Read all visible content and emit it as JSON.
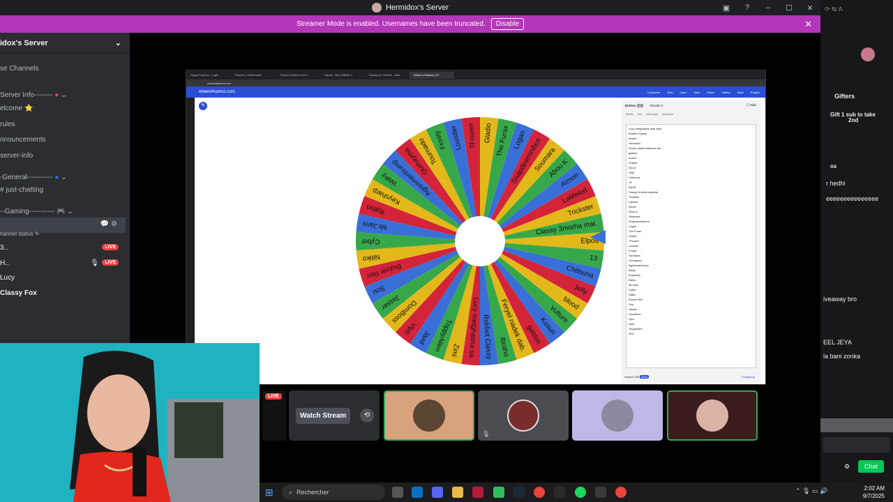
{
  "titlebar": {
    "title": "Hermidox's Server"
  },
  "banner": {
    "text": "Streamer Mode is enabled. Usernames have been truncated.",
    "disable_label": "Disable"
  },
  "sidebar": {
    "server_name": "idox's Server",
    "items": [
      {
        "label": "se Channels"
      },
      {
        "label": "Server Info--------"
      },
      {
        "label": "elcome ⭐"
      },
      {
        "label": "rules"
      },
      {
        "label": "nnouncements"
      },
      {
        "label": "server-info"
      },
      {
        "label": "-General-----------"
      },
      {
        "label": "just-chatting"
      },
      {
        "label": "--Gaming----------- 🎮"
      }
    ],
    "channel_status": "hannel status",
    "members": [
      {
        "name": "3..",
        "live": "LIVE"
      },
      {
        "name": "H..",
        "live": "LIVE"
      },
      {
        "name": "Lucy"
      },
      {
        "name": "Classy Fox"
      }
    ]
  },
  "browser": {
    "tabs": [
      "Skype Express - Login",
      "Reactor | Maréchales",
      "Themed Drafted and V",
      "Naruto - Bon Difficile V",
      "Racing Dx Stricker - Wiki",
      "Wheel of Names | Fr"
    ],
    "url": "wheelofnames.com",
    "site": "wheelofnames.com",
    "menu": [
      "Customize",
      "New",
      "Open",
      "Save",
      "Share",
      "Gallery",
      "More",
      "English"
    ],
    "entries_tab": "Entries",
    "entries_count": "49",
    "results_tab": "Results",
    "results_count": "0",
    "hide_label": "Hide",
    "tools": [
      "Shuffle",
      "Sort",
      "Add image",
      "Advanced"
    ],
    "entries": [
      "Lucy metghasha sala Jelly",
      "Rokbet Classy",
      "Ibraho",
      "Hermidox",
      "Feryel nadek dabouza mé",
      "gaston",
      "Kosuri",
      "Vulture",
      "blood",
      "Jelly",
      "Chifouna",
      "13",
      "Elpo9",
      "Classy 3morha mats3ar",
      "Trickster",
      "Lalelod",
      "Aimon",
      "Abou K",
      "Soumara",
      "Snapdesminibus",
      "Logan",
      "The Furax",
      "Gladio",
      "TFrozen",
      "Loustler",
      "Frosty",
      "Tournado",
      "Oumayma",
      "Agreementrump",
      "Waky",
      "Keysharp",
      "Rafoo",
      "Mr.Jans",
      "Cyber",
      "Nitiko",
      "Buzzer Rec",
      "Sou",
      "Jasser",
      "DomBoss",
      "Vipo",
      "Jaxd",
      "TrippyAlien",
      "Zimi"
    ],
    "version": "Version 378",
    "version_badge": "New!",
    "changelog": "Changelog"
  },
  "wheel": {
    "colors": [
      "#e3b81a",
      "#37a84a",
      "#3a6fd8",
      "#d4243a"
    ],
    "labels": [
      "Elpo9",
      "13",
      "Chifouna",
      "Jelly",
      "blood",
      "Vulture",
      "Kosuri",
      "gaston",
      "Feryel nadek dab.",
      "Ibraho",
      "Rokbet Classy",
      "Lucy metghasha sa.",
      "Zimi",
      "TrippyAlien",
      "Jaxd",
      "Vipo",
      "DomBoss",
      "Jasser",
      "Sou",
      "Buzzer Rec",
      "Nitiko",
      "Cyber",
      "Mr.Jans",
      "Rafoo",
      "Keysharp",
      "Waky",
      "Agreementrump",
      "Oumayma",
      "Tournado",
      "Frosty",
      "Loustler",
      "TFrozen",
      "Gladio",
      "The Furax",
      "Logan",
      "Snapdesminibus",
      "Soumara",
      "Abou K",
      "Aimon",
      "LaMelod",
      "Trickster",
      "Classy 3morha mat."
    ]
  },
  "tiles": {
    "live_badge": "LIVE",
    "watch_label": "Watch Stream"
  },
  "rightpanel": {
    "gifters": "Gifters",
    "gift_line1": "Gift 1 sub to take",
    "gift_line2": "2nd",
    "ox": "ox",
    "r_hedhi": "r hedhi",
    "eee": "eeeeeeeeeeeeeee",
    "giveaway": "iveaway bro",
    "eel": "EEL JEYA",
    "zonka": "la bani zonka",
    "chat_label": "Chat"
  },
  "taskbar": {
    "search_placeholder": "Rechercher",
    "time": "2:02 AM",
    "date": "9/7/2025"
  }
}
